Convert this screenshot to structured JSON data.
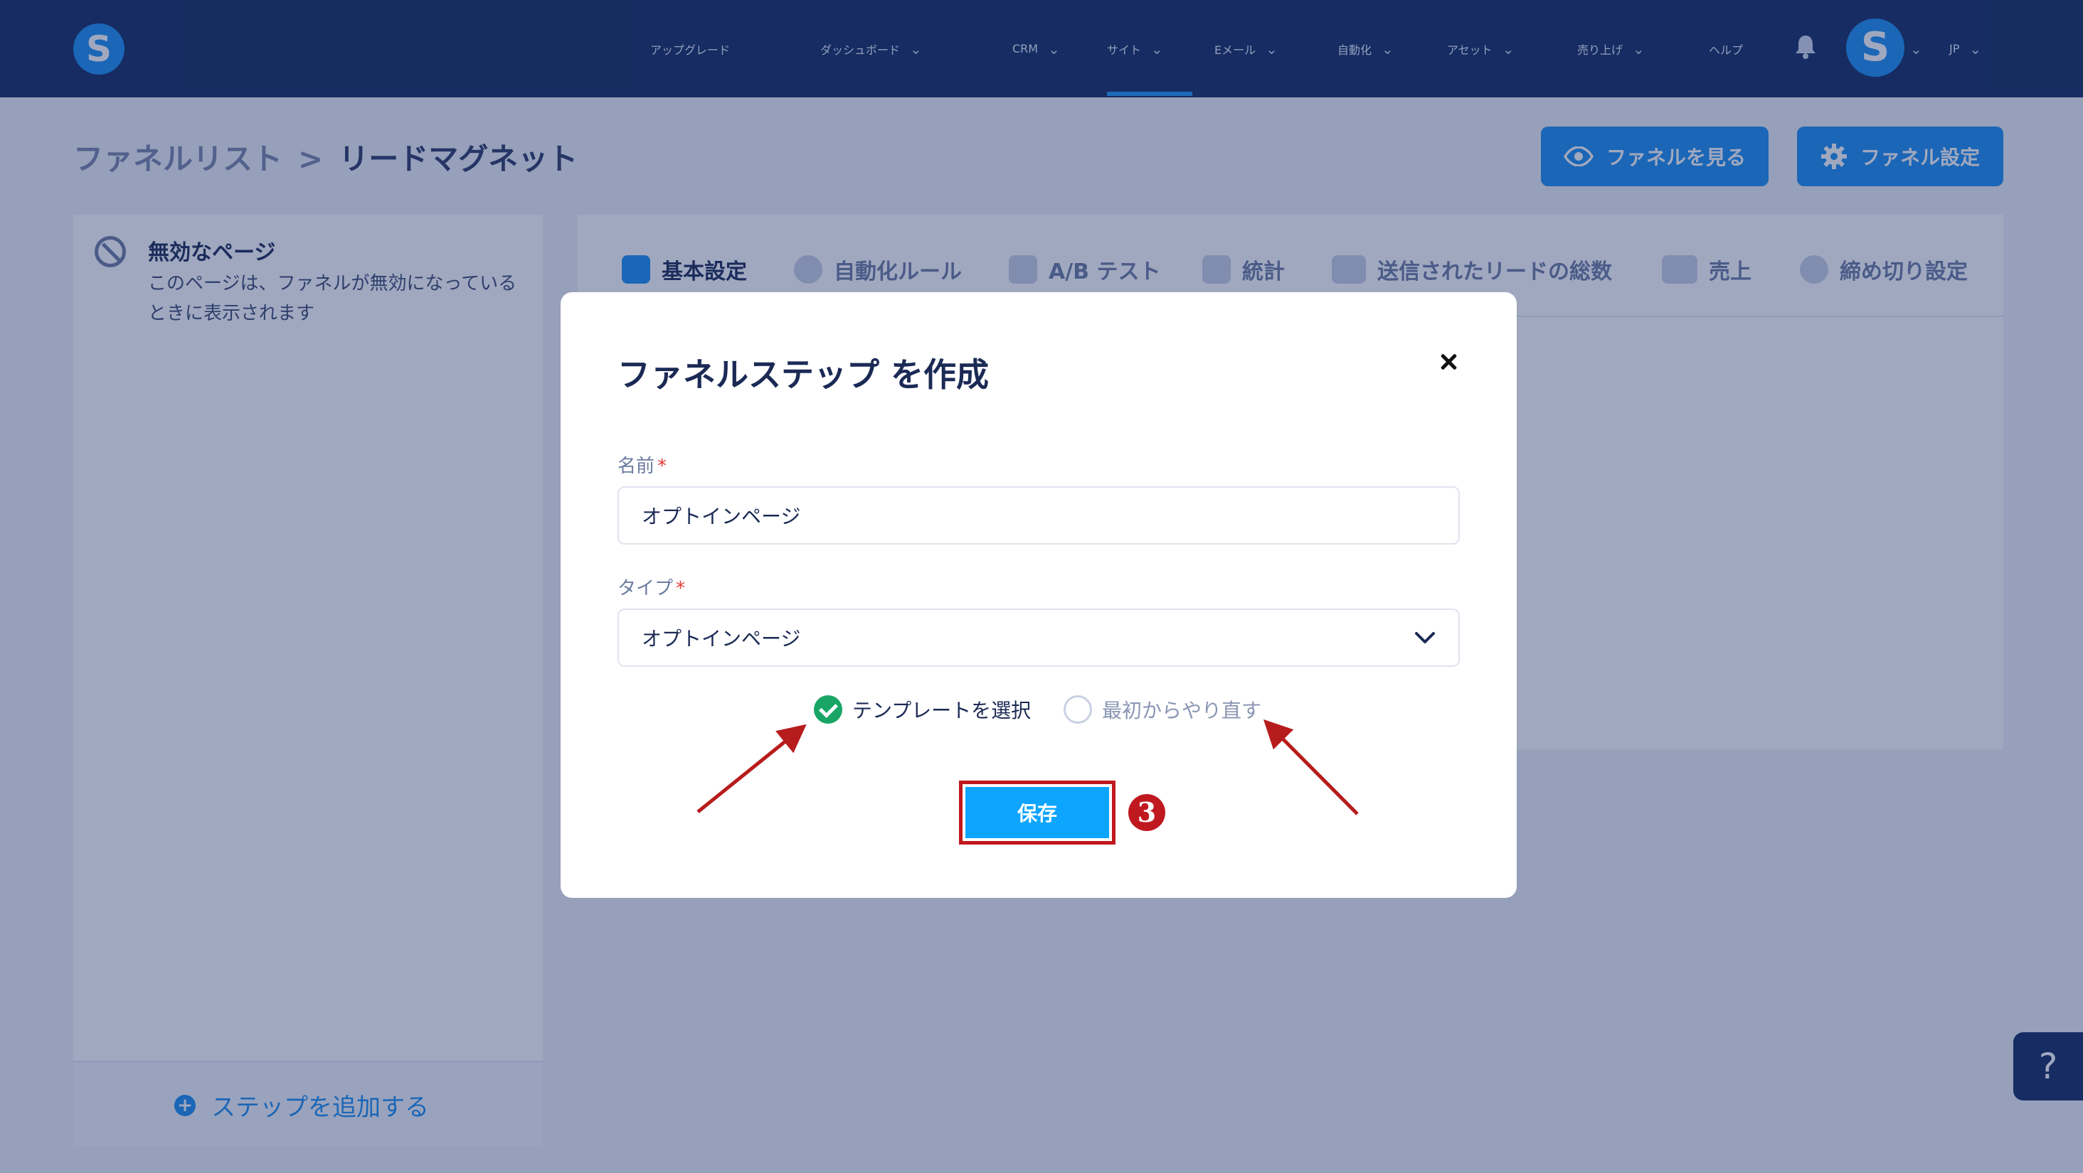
{
  "nav": {
    "items": [
      {
        "label": "アップグレード",
        "has_menu": false
      },
      {
        "label": "ダッシュボード",
        "has_menu": true
      },
      {
        "label": "CRM",
        "has_menu": true
      },
      {
        "label": "サイト",
        "has_menu": true,
        "active": true
      },
      {
        "label": "Eメール",
        "has_menu": true
      },
      {
        "label": "自動化",
        "has_menu": true
      },
      {
        "label": "アセット",
        "has_menu": true
      },
      {
        "label": "売り上げ",
        "has_menu": true
      },
      {
        "label": "ヘルプ",
        "has_menu": false
      }
    ],
    "logo_letter": "S",
    "avatar_letter": "S",
    "language": "JP"
  },
  "breadcrumb": {
    "parent": "ファネルリスト",
    "separator": ">",
    "current": "リードマグネット"
  },
  "header_buttons": {
    "view_funnel": "ファネルを見る",
    "funnel_settings": "ファネル設定"
  },
  "left_panel": {
    "title": "無効なページ",
    "description": "このページは、ファネルが無効になっているときに表示されます",
    "add_step": "ステップを追加する"
  },
  "tabs": [
    {
      "label": "基本設定",
      "icon": "sliders-icon",
      "active": true
    },
    {
      "label": "自動化ルール",
      "icon": "bolt-icon"
    },
    {
      "label": "A/B テスト",
      "icon": "split-icon"
    },
    {
      "label": "統計",
      "icon": "bar-chart-icon"
    },
    {
      "label": "送信されたリードの総数",
      "icon": "users-icon"
    },
    {
      "label": "売上",
      "icon": "dollar-icon"
    },
    {
      "label": "締め切り設定",
      "icon": "clock-icon"
    }
  ],
  "modal": {
    "title": "ファネルステップ を作成",
    "name_label": "名前",
    "name_value": "オプトインページ",
    "type_label": "タイプ",
    "type_value": "オプトインページ",
    "required_mark": "*",
    "option_template": "テンプレートを選択",
    "option_scratch": "最初からやり直す",
    "selected_option": "template",
    "save_label": "保存",
    "step_marker": "3"
  },
  "help_label": "?",
  "colors": {
    "nav_bg": "#122a5f",
    "accent": "#1b8df0",
    "save": "#0ea5ff",
    "highlight": "#c0181f",
    "success": "#18a565"
  }
}
